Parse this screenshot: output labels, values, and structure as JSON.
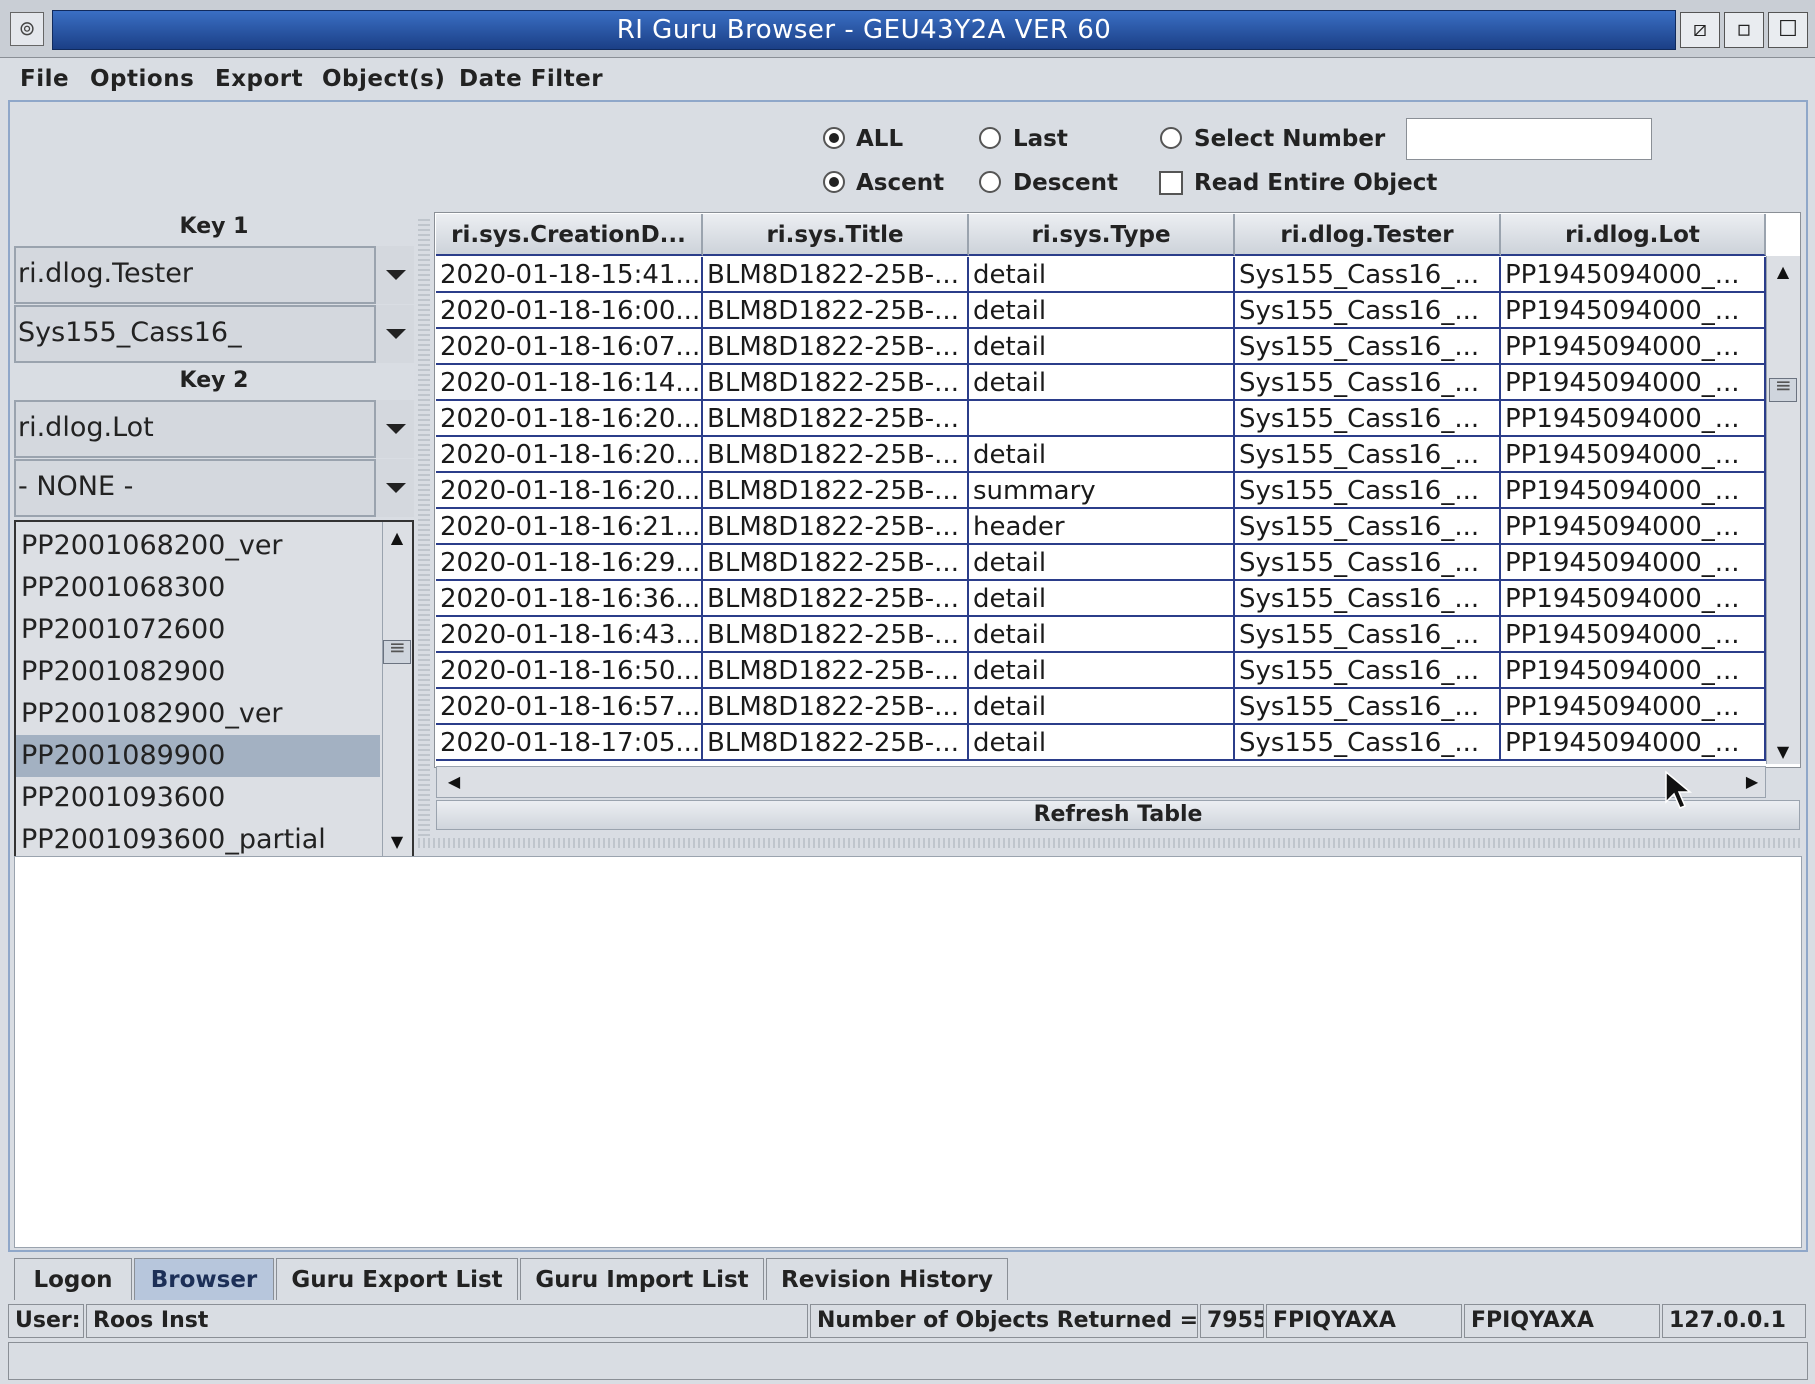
{
  "window": {
    "title": "RI Guru Browser - GEU43Y2A  VER 60",
    "sys_icon": "⊚",
    "controls": [
      "⧄",
      "▫",
      "☐"
    ]
  },
  "menu": [
    "File",
    "Options",
    "Export",
    "Object(s)",
    "Date Filter"
  ],
  "options": {
    "all": "ALL",
    "last": "Last",
    "select_number": "Select Number",
    "ascent": "Ascent",
    "descent": "Descent",
    "read_entire": "Read Entire Object",
    "select_number_value": ""
  },
  "left": {
    "key1_label": "Key 1",
    "key1_field": "ri.dlog.Tester",
    "key1_value": "Sys155_Cass16_",
    "key2_label": "Key 2",
    "key2_field": "ri.dlog.Lot",
    "key2_value": "- NONE -",
    "list": [
      "PP2001068200_ver",
      "PP2001068300",
      "PP2001072600",
      "PP2001082900",
      "PP2001082900_ver",
      "PP2001089900",
      "PP2001093600",
      "PP2001093600_partial"
    ],
    "selected_index": 5
  },
  "table": {
    "columns": [
      "ri.sys.CreationD...",
      "ri.sys.Title",
      "ri.sys.Type",
      "ri.dlog.Tester",
      "ri.dlog.Lot"
    ],
    "rows": [
      [
        "2020-01-18-15:41...",
        "BLM8D1822-25B-...",
        "detail",
        "Sys155_Cass16_...",
        "PP1945094000_..."
      ],
      [
        "2020-01-18-16:00...",
        "BLM8D1822-25B-...",
        "detail",
        "Sys155_Cass16_...",
        "PP1945094000_..."
      ],
      [
        "2020-01-18-16:07...",
        "BLM8D1822-25B-...",
        "detail",
        "Sys155_Cass16_...",
        "PP1945094000_..."
      ],
      [
        "2020-01-18-16:14...",
        "BLM8D1822-25B-...",
        "detail",
        "Sys155_Cass16_...",
        "PP1945094000_..."
      ],
      [
        "2020-01-18-16:20...",
        "BLM8D1822-25B-...",
        "",
        "Sys155_Cass16_...",
        "PP1945094000_..."
      ],
      [
        "2020-01-18-16:20...",
        "BLM8D1822-25B-...",
        "detail",
        "Sys155_Cass16_...",
        "PP1945094000_..."
      ],
      [
        "2020-01-18-16:20...",
        "BLM8D1822-25B-...",
        "summary",
        "Sys155_Cass16_...",
        "PP1945094000_..."
      ],
      [
        "2020-01-18-16:21...",
        "BLM8D1822-25B-...",
        "header",
        "Sys155_Cass16_...",
        "PP1945094000_..."
      ],
      [
        "2020-01-18-16:29...",
        "BLM8D1822-25B-...",
        "detail",
        "Sys155_Cass16_...",
        "PP1945094000_..."
      ],
      [
        "2020-01-18-16:36...",
        "BLM8D1822-25B-...",
        "detail",
        "Sys155_Cass16_...",
        "PP1945094000_..."
      ],
      [
        "2020-01-18-16:43...",
        "BLM8D1822-25B-...",
        "detail",
        "Sys155_Cass16_...",
        "PP1945094000_..."
      ],
      [
        "2020-01-18-16:50...",
        "BLM8D1822-25B-...",
        "detail",
        "Sys155_Cass16_...",
        "PP1945094000_..."
      ],
      [
        "2020-01-18-16:57...",
        "BLM8D1822-25B-...",
        "detail",
        "Sys155_Cass16_...",
        "PP1945094000_..."
      ],
      [
        "2020-01-18-17:05...",
        "BLM8D1822-25B-...",
        "detail",
        "Sys155_Cass16_...",
        "PP1945094000_..."
      ]
    ],
    "refresh_label": "Refresh Table"
  },
  "tabs": [
    "Logon",
    "Browser",
    "Guru Export List",
    "Guru Import List",
    "Revision History"
  ],
  "active_tab": "Browser",
  "status": {
    "user_label": "User:",
    "user_value": "Roos Inst",
    "count_label": "Number of Objects Returned =",
    "count_value": "7955",
    "field1": "FPIQYAXA",
    "field2": "FPIQYAXA",
    "ip": "127.0.0.1"
  },
  "colors": {
    "title_bar": "#1b3f86",
    "grid_lines": "#2b3d8a",
    "selection": "#a3b1c2"
  }
}
